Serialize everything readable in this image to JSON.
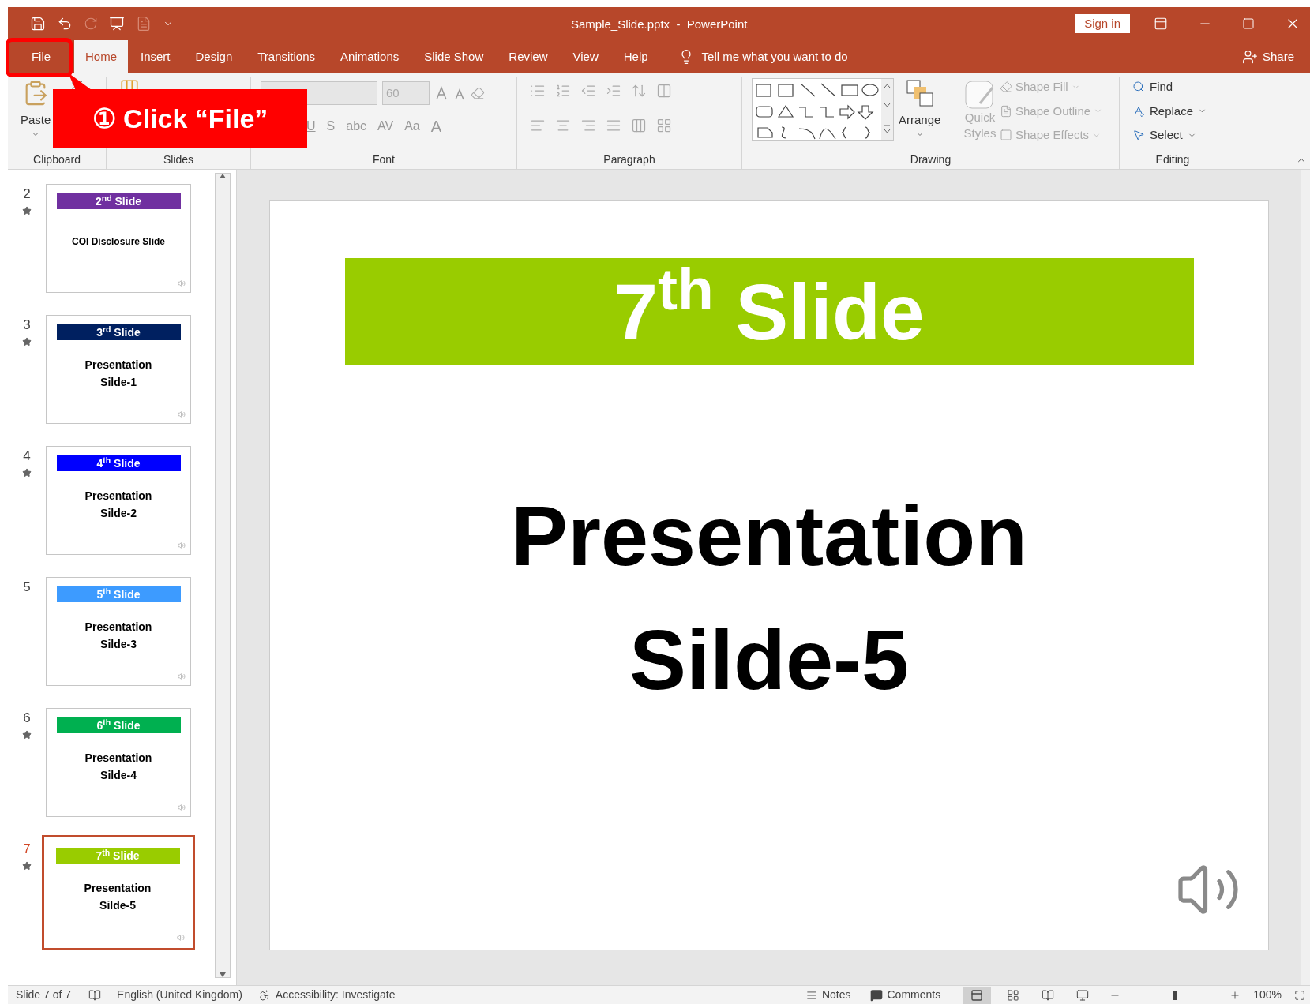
{
  "window": {
    "title": "Sample_Slide.pptx  -  PowerPoint",
    "sign_in": "Sign in"
  },
  "tabs": [
    {
      "label": "File",
      "selected": false
    },
    {
      "label": "Home",
      "selected": true
    },
    {
      "label": "Insert",
      "selected": false
    },
    {
      "label": "Design",
      "selected": false
    },
    {
      "label": "Transitions",
      "selected": false
    },
    {
      "label": "Animations",
      "selected": false
    },
    {
      "label": "Slide Show",
      "selected": false
    },
    {
      "label": "Review",
      "selected": false
    },
    {
      "label": "View",
      "selected": false
    },
    {
      "label": "Help",
      "selected": false
    }
  ],
  "tell_me": "Tell me what you want to do",
  "share": "Share",
  "ribbon": {
    "clipboard": {
      "label": "Clipboard",
      "paste": "Paste"
    },
    "slides": {
      "label": "Slides"
    },
    "font": {
      "label": "Font",
      "size": "60",
      "buttons": [
        "U",
        "S",
        "abc",
        "AV",
        "Aa",
        "A"
      ]
    },
    "paragraph": {
      "label": "Paragraph"
    },
    "drawing": {
      "label": "Drawing",
      "arrange": {
        "label": "Arrange",
        "disabled": false
      },
      "quick_styles": {
        "label": "Quick Styles",
        "disabled": true
      },
      "commands": [
        {
          "label": "Shape Fill",
          "disabled": true
        },
        {
          "label": "Shape Outline",
          "disabled": true
        },
        {
          "label": "Shape Effects",
          "disabled": true
        }
      ]
    },
    "editing": {
      "label": "Editing",
      "commands": [
        "Find",
        "Replace",
        "Select"
      ]
    }
  },
  "callout": "① Click “File”",
  "thumbnails": [
    {
      "number": "2",
      "animated": true,
      "selected": false,
      "color": "#7030a0",
      "header": "2$^{nd}$ Slide",
      "body": [
        "COI Disclosure Slide"
      ]
    },
    {
      "number": "3",
      "animated": true,
      "selected": false,
      "color": "#002060",
      "header": "3$^{rd}$ Slide",
      "body": [
        "Presentation",
        "Silde-1"
      ]
    },
    {
      "number": "4",
      "animated": true,
      "selected": false,
      "color": "#0000ff",
      "header": "4$^{th}$ Slide",
      "body": [
        "Presentation",
        "Silde-2"
      ]
    },
    {
      "number": "5",
      "animated": false,
      "selected": false,
      "color": "#3d9bff",
      "header": "5$^{th}$ Slide",
      "body": [
        "Presentation",
        "Silde-3"
      ]
    },
    {
      "number": "6",
      "animated": true,
      "selected": false,
      "color": "#00b050",
      "header": "6$^{th}$ Slide",
      "body": [
        "Presentation",
        "Silde-4"
      ]
    },
    {
      "number": "7",
      "animated": true,
      "selected": true,
      "color": "#99cc00",
      "header": "7$^{th}$ Slide",
      "body": [
        "Presentation",
        "Silde-5"
      ]
    }
  ],
  "slide": {
    "title": "7$^{th}$ Slide",
    "body": [
      "Presentation",
      "Silde-5"
    ]
  },
  "status_bar": {
    "slide": "Slide 7 of 7",
    "language": "English (United Kingdom)",
    "accessibility": "Accessibility: Investigate",
    "notes": "Notes",
    "comments": "Comments",
    "zoom": {
      "level": 0.5
    },
    "zoom_reading": "100%"
  }
}
